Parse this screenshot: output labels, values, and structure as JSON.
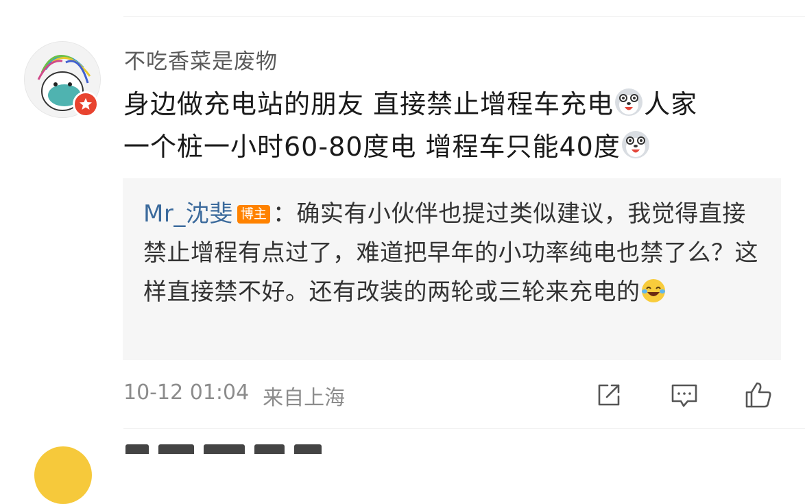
{
  "comment": {
    "username": "不吃香菜是废物",
    "text_line1": "身边做充电站的朋友 直接禁止增程车充电",
    "text_line1_tail": "人家",
    "text_line2": "一个桩一小时60-80度电 增程车只能40度",
    "emoji_after_line1": "grinning-husky-emoji",
    "emoji_after_line2": "grinning-husky-emoji",
    "timestamp": "10-12 01:04",
    "location": "来自上海"
  },
  "reply": {
    "author": "Mr_沈斐",
    "badge": "博主",
    "separator": "：",
    "text": "确实有小伙伴也提过类似建议，我觉得直接禁止增程有点过了，难道把早年的小功率纯电也禁了么？这样直接禁不好。还有改装的两轮或三轮来充电的",
    "emoji": "laughing-tears-emoji"
  },
  "actions": {
    "share_icon": "share-icon",
    "comment_icon": "comment-icon",
    "like_icon": "thumbs-up-icon"
  },
  "colors": {
    "username": "#5a5a5a",
    "reply_author": "#3b6a9c",
    "badge_bg": "#ff8200",
    "verified_badge": "#e8432f",
    "reply_bg": "#f6f6f6",
    "meta": "#8c8c8c"
  }
}
